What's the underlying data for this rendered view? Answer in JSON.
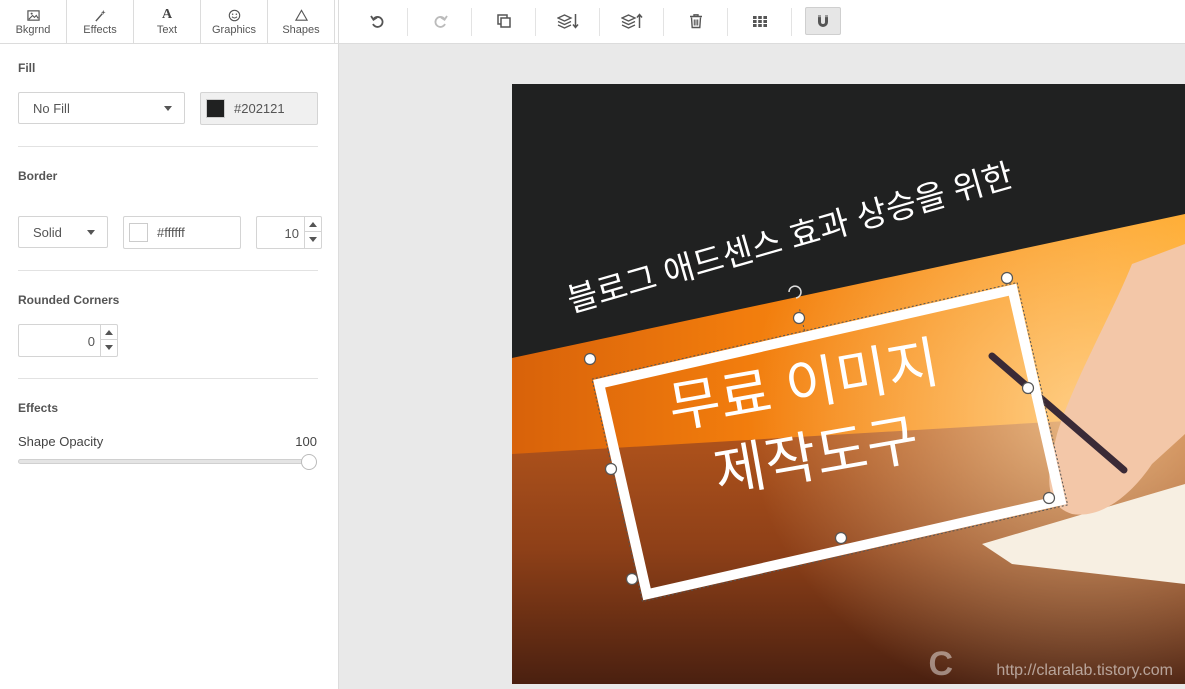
{
  "tabs": [
    {
      "label": "Bkgrnd",
      "icon": "image-icon"
    },
    {
      "label": "Effects",
      "icon": "magic-wand-icon"
    },
    {
      "label": "Text",
      "icon": "text-icon",
      "glyph": "A"
    },
    {
      "label": "Graphics",
      "icon": "smiley-icon"
    },
    {
      "label": "Shapes",
      "icon": "triangle-icon"
    }
  ],
  "fill": {
    "title": "Fill",
    "type_value": "No Fill",
    "color_hex": "#202121",
    "color_swatch": "#202121"
  },
  "border": {
    "title": "Border",
    "style_value": "Solid",
    "color_hex": "#ffffff",
    "color_swatch": "#ffffff",
    "width_value": "10"
  },
  "rounded": {
    "title": "Rounded Corners",
    "value": "0"
  },
  "effects": {
    "title": "Effects",
    "opacity_label": "Shape Opacity",
    "opacity_value": "100",
    "opacity_fraction": 1.0
  },
  "toolbar": {
    "buttons": [
      "undo-icon",
      "redo-icon",
      "duplicate-icon",
      "send-backward-icon",
      "bring-forward-icon",
      "delete-icon",
      "grid-icon",
      "magnet-icon"
    ],
    "active": "magnet-icon"
  },
  "canvas": {
    "subtitle": "블로그 애드센스 효과 상승을 위한",
    "title_line1": "무료 이미지",
    "title_line2": "제작도구",
    "watermark": "http://claralab.tistory.com",
    "watermark_logo": "C",
    "dark_color": "#202121",
    "orange_color": "#f58a12"
  }
}
